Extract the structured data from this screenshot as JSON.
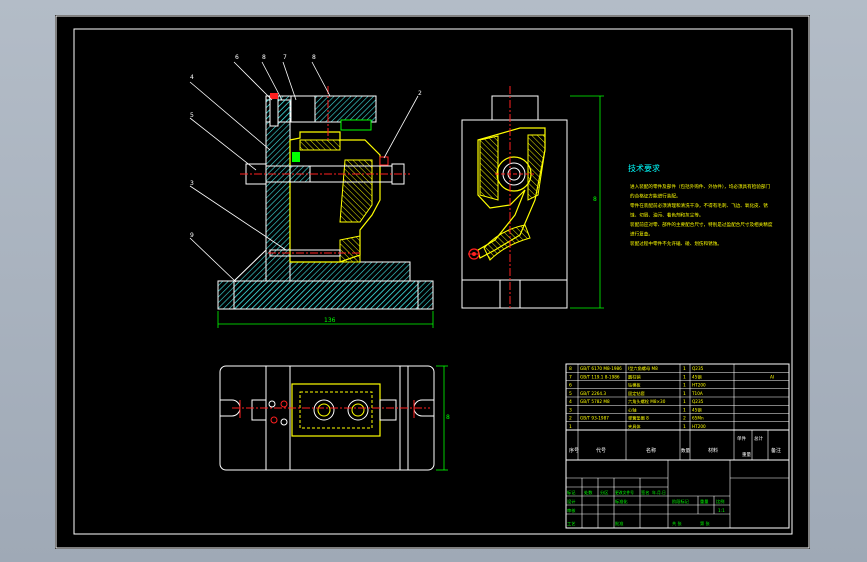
{
  "balloons": [
    "6",
    "8",
    "7",
    "8",
    "4",
    "5",
    "3",
    "9",
    "2",
    "1"
  ],
  "dimensions": {
    "front_width": "136",
    "side_height": "8",
    "plan_height": "8"
  },
  "tech_requirements": {
    "title": "技术要求",
    "lines": [
      "进入装配的零件及部件（包括外购件、外协件），均必须具有检验部门",
      "的合格证方能进行装配。",
      "零件在装配前必须清理和清洗干净，不得有毛刺、飞边、氧化皮、锈",
      "蚀、切屑、油污、着色剂和灰尘等。",
      "装配前应对零、部件的主要配合尺寸，特别是过盈配合尺寸及相关精度",
      "进行复查。",
      "装配过程中零件不允许磕、碰、划伤和锈蚀。"
    ]
  },
  "bom": {
    "rows": [
      {
        "no": "8",
        "code": "GB/T 6170 M8-1986",
        "name": "I型六角螺母 M8",
        "qty": "1",
        "material": "Q235",
        "remark": ""
      },
      {
        "no": "7",
        "code": "GB/T 119.1 8-1986",
        "name": "圆柱销",
        "qty": "1",
        "material": "45钢",
        "remark": "AI"
      },
      {
        "no": "6",
        "code": "",
        "name": "钻模板",
        "qty": "1",
        "material": "HT200",
        "remark": ""
      },
      {
        "no": "5",
        "code": "GB/T 2264.3",
        "name": "固定钻套",
        "qty": "1",
        "material": "T10A",
        "remark": ""
      },
      {
        "no": "4",
        "code": "GB/T 5782 M8",
        "name": "六角头螺栓 M8×30",
        "qty": "1",
        "material": "Q235",
        "remark": ""
      },
      {
        "no": "3",
        "code": "",
        "name": "心轴",
        "qty": "1",
        "material": "45钢",
        "remark": ""
      },
      {
        "no": "2",
        "code": "GB/T 93-1987",
        "name": "弹簧垫圈 8",
        "qty": "2",
        "material": "65Mn",
        "remark": ""
      },
      {
        "no": "1",
        "code": "",
        "name": "夹具体",
        "qty": "1",
        "material": "HT200",
        "remark": ""
      }
    ],
    "header": {
      "no": "序号",
      "code": "代号",
      "name": "名称",
      "qty": "数量",
      "material": "材料",
      "unit_weight": "单件",
      "total_weight": "总计",
      "weight": "重量",
      "remark": "备注"
    }
  },
  "title_block": {
    "labels": {
      "mark": "标记",
      "count": "处数",
      "zone": "分区",
      "change_doc": "更改文件号",
      "sign": "签名",
      "date": "年.月.日",
      "designer": "设计",
      "standardize": "标准化",
      "reviewer": "审核",
      "process": "工艺",
      "approve": "批准",
      "stage_mark": "阶段标记",
      "weight": "重量",
      "scale": "比例",
      "sheets": "共 张",
      "sheet_no": "第 张"
    },
    "scale_value": "1:1"
  },
  "colors": {
    "background": "#000000",
    "frame": "#ffffff",
    "outline": "#ffffff",
    "part_fill": "#ffff00",
    "hatch": "#40e0e0",
    "centerline": "#ff2020",
    "dimension": "#00ff00",
    "leader": "#ffffff",
    "table_text": "#ffff00",
    "tech_title": "#00ffff",
    "tech_text": "#ffff00",
    "window": "#a9b3bf"
  }
}
